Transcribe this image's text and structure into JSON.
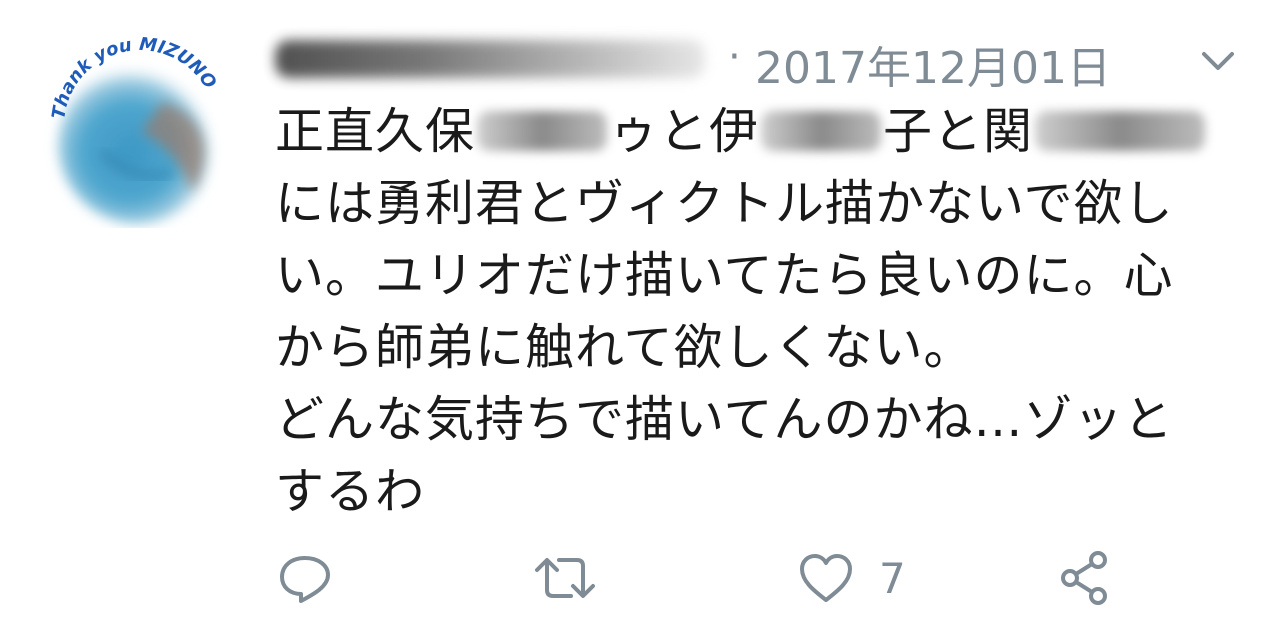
{
  "tweet": {
    "avatar": {
      "text": "Thank you MIZUNO"
    },
    "header": {
      "separator": "·",
      "date": "2017年12月01日",
      "menu_icon": "chevron-down-icon"
    },
    "body": {
      "line1_a": "正直久保",
      "line1_b": "ゥと伊",
      "line1_c": "子と関",
      "line2": "には勇利君とヴィクトル描かないで欲し",
      "line3": "い。ユリオだけ描いてたら良いのに。心",
      "line4": "から師弟に触れて欲しくない。",
      "line5": "どんな気持ちで描いてんのかね…ゾッと",
      "line6": "するわ"
    },
    "actions": {
      "reply_icon": "reply-icon",
      "retweet_icon": "retweet-icon",
      "like_icon": "heart-icon",
      "like_count": "7",
      "share_icon": "share-icon"
    },
    "colors": {
      "text": "#1a1a1a",
      "muted": "#7f8b95",
      "avatar_blue": "#1f5bb8",
      "avatar_cyan": "#4fa7cf"
    }
  }
}
